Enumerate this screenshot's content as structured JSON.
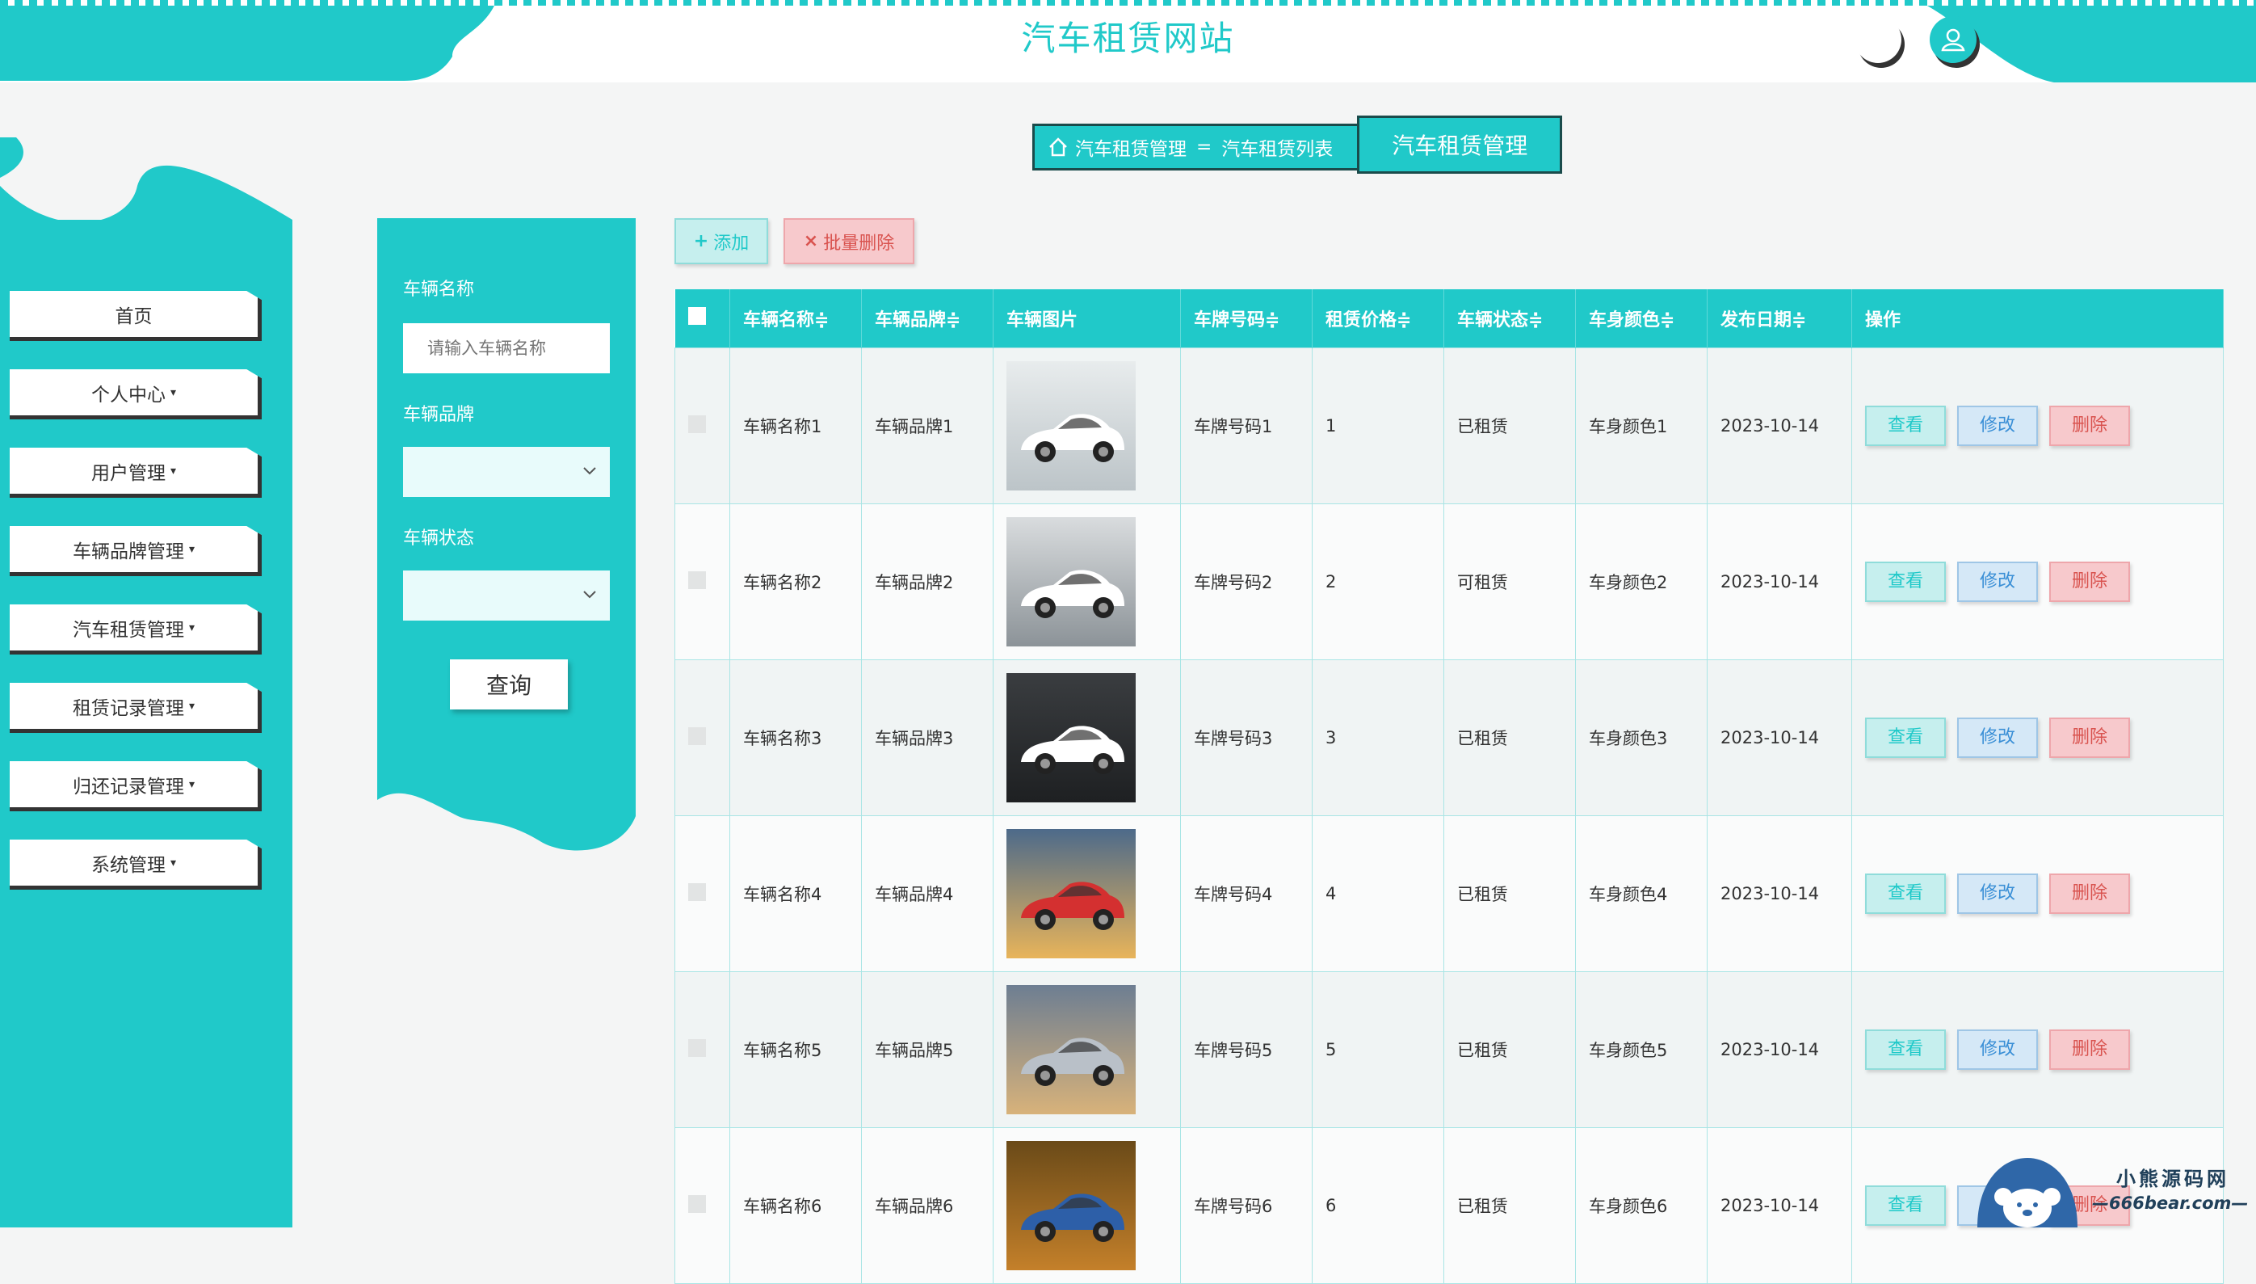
{
  "header": {
    "title": "汽车租赁网站"
  },
  "breadcrumb": {
    "home_label": "汽车租赁管理",
    "separator": "=",
    "current": "汽车租赁列表",
    "page_title": "汽车租赁管理"
  },
  "sidebar": {
    "items": [
      {
        "label": "首页",
        "has_dropdown": false
      },
      {
        "label": "个人中心",
        "has_dropdown": true
      },
      {
        "label": "用户管理",
        "has_dropdown": true
      },
      {
        "label": "车辆品牌管理",
        "has_dropdown": true
      },
      {
        "label": "汽车租赁管理",
        "has_dropdown": true
      },
      {
        "label": "租赁记录管理",
        "has_dropdown": true
      },
      {
        "label": "归还记录管理",
        "has_dropdown": true
      },
      {
        "label": "系统管理",
        "has_dropdown": true
      }
    ]
  },
  "search": {
    "name_label": "车辆名称",
    "name_placeholder": "请输入车辆名称",
    "brand_label": "车辆品牌",
    "status_label": "车辆状态",
    "submit_label": "查询"
  },
  "toolbar": {
    "add_label": "添加",
    "batch_delete_label": "批量删除"
  },
  "table": {
    "columns": [
      "车辆名称",
      "车辆品牌",
      "车辆图片",
      "车牌号码",
      "租赁价格",
      "车辆状态",
      "车身颜色",
      "发布日期",
      "操作"
    ],
    "sort_glyph": "≑",
    "actions": {
      "view": "查看",
      "edit": "修改",
      "delete": "删除"
    },
    "rows": [
      {
        "name": "车辆名称1",
        "brand": "车辆品牌1",
        "image": "white-audi-sedan",
        "plate": "车牌号码1",
        "price": "1",
        "status": "已租赁",
        "color": "车身颜色1",
        "date": "2023-10-14"
      },
      {
        "name": "车辆名称2",
        "brand": "车辆品牌2",
        "image": "white-bmw-showroom",
        "plate": "车牌号码2",
        "price": "2",
        "status": "可租赁",
        "color": "车身颜色2",
        "date": "2023-10-14"
      },
      {
        "name": "车辆名称3",
        "brand": "车辆品牌3",
        "image": "white-convertible-dark",
        "plate": "车牌号码3",
        "price": "3",
        "status": "已租赁",
        "color": "车身颜色3",
        "date": "2023-10-14"
      },
      {
        "name": "车辆名称4",
        "brand": "车辆品牌4",
        "image": "red-sports-car-sunset",
        "plate": "车牌号码4",
        "price": "4",
        "status": "已租赁",
        "color": "车身颜色4",
        "date": "2023-10-14"
      },
      {
        "name": "车辆名称5",
        "brand": "车辆品牌5",
        "image": "silver-bmw-i8-sunset",
        "plate": "车牌号码5",
        "price": "5",
        "status": "已租赁",
        "color": "车身颜色5",
        "date": "2023-10-14"
      },
      {
        "name": "车辆名称6",
        "brand": "车辆品牌6",
        "image": "blue-car-autumn",
        "plate": "车牌号码6",
        "price": "6",
        "status": "已租赁",
        "color": "车身颜色6",
        "date": "2023-10-14"
      }
    ]
  },
  "watermark": {
    "line1": "小熊源码网",
    "line2": "—666bear.com—"
  },
  "colors": {
    "accent": "#20c9c9",
    "danger": "#d9534f",
    "info": "#3a8fd6"
  }
}
